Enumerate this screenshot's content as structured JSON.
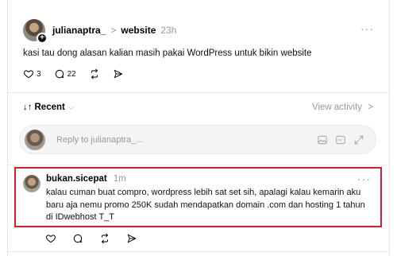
{
  "post": {
    "username": "julianaptra_",
    "separator": ">",
    "topic": "website",
    "time": "23h",
    "more": "···",
    "text": "kasi tau dong alasan kalian masih pakai WordPress untuk bikin website",
    "likes": "3",
    "comments": "22",
    "avatar_badge": "+"
  },
  "icons": {
    "like": "heart-icon",
    "comment": "comment-icon",
    "repost": "repost-icon",
    "share": "send-icon"
  },
  "activity": {
    "sort_label": "Recent",
    "sort_icon": "↓↑",
    "sort_chevron": "⌵",
    "view_activity": "View activity",
    "view_chevron": ">"
  },
  "reply": {
    "placeholder": "Reply to julianaptra_..."
  },
  "comment": {
    "username": "bukan.sicepat",
    "time": "1m",
    "more": "···",
    "text": "kalau cuman buat compro, wordpress lebih sat set sih, apalagi kalau kemarin aku baru aja nemu promo 250K sudah mendapatkan domain .com dan hosting 1 tahun di IDwebhost T_T"
  },
  "colors": {
    "highlight_border": "#d0202b",
    "muted_text": "#999999",
    "reply_bg": "#f4f4f4"
  }
}
